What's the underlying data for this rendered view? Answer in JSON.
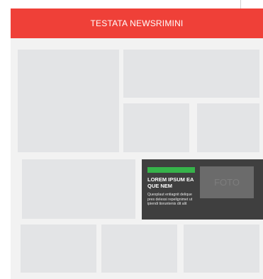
{
  "header": {
    "title": "TESTATA NEWSRIMINI"
  },
  "featured": {
    "title": "LOREM IPSUM EA QUE NEM",
    "text": "Quexplaut entiagnit delique pres delessi repelignimet ut ipiendi tioruntenis dit alit",
    "photo_label": "FOTO"
  },
  "colors": {
    "header_bg": "#ef4038",
    "body_bg": "#f2f2f2",
    "placeholder_block": "#e3e4e6",
    "featured_bg": "#3f3f3f",
    "featured_tag": "#36b34a",
    "photo_bg": "#6b6b6b"
  }
}
